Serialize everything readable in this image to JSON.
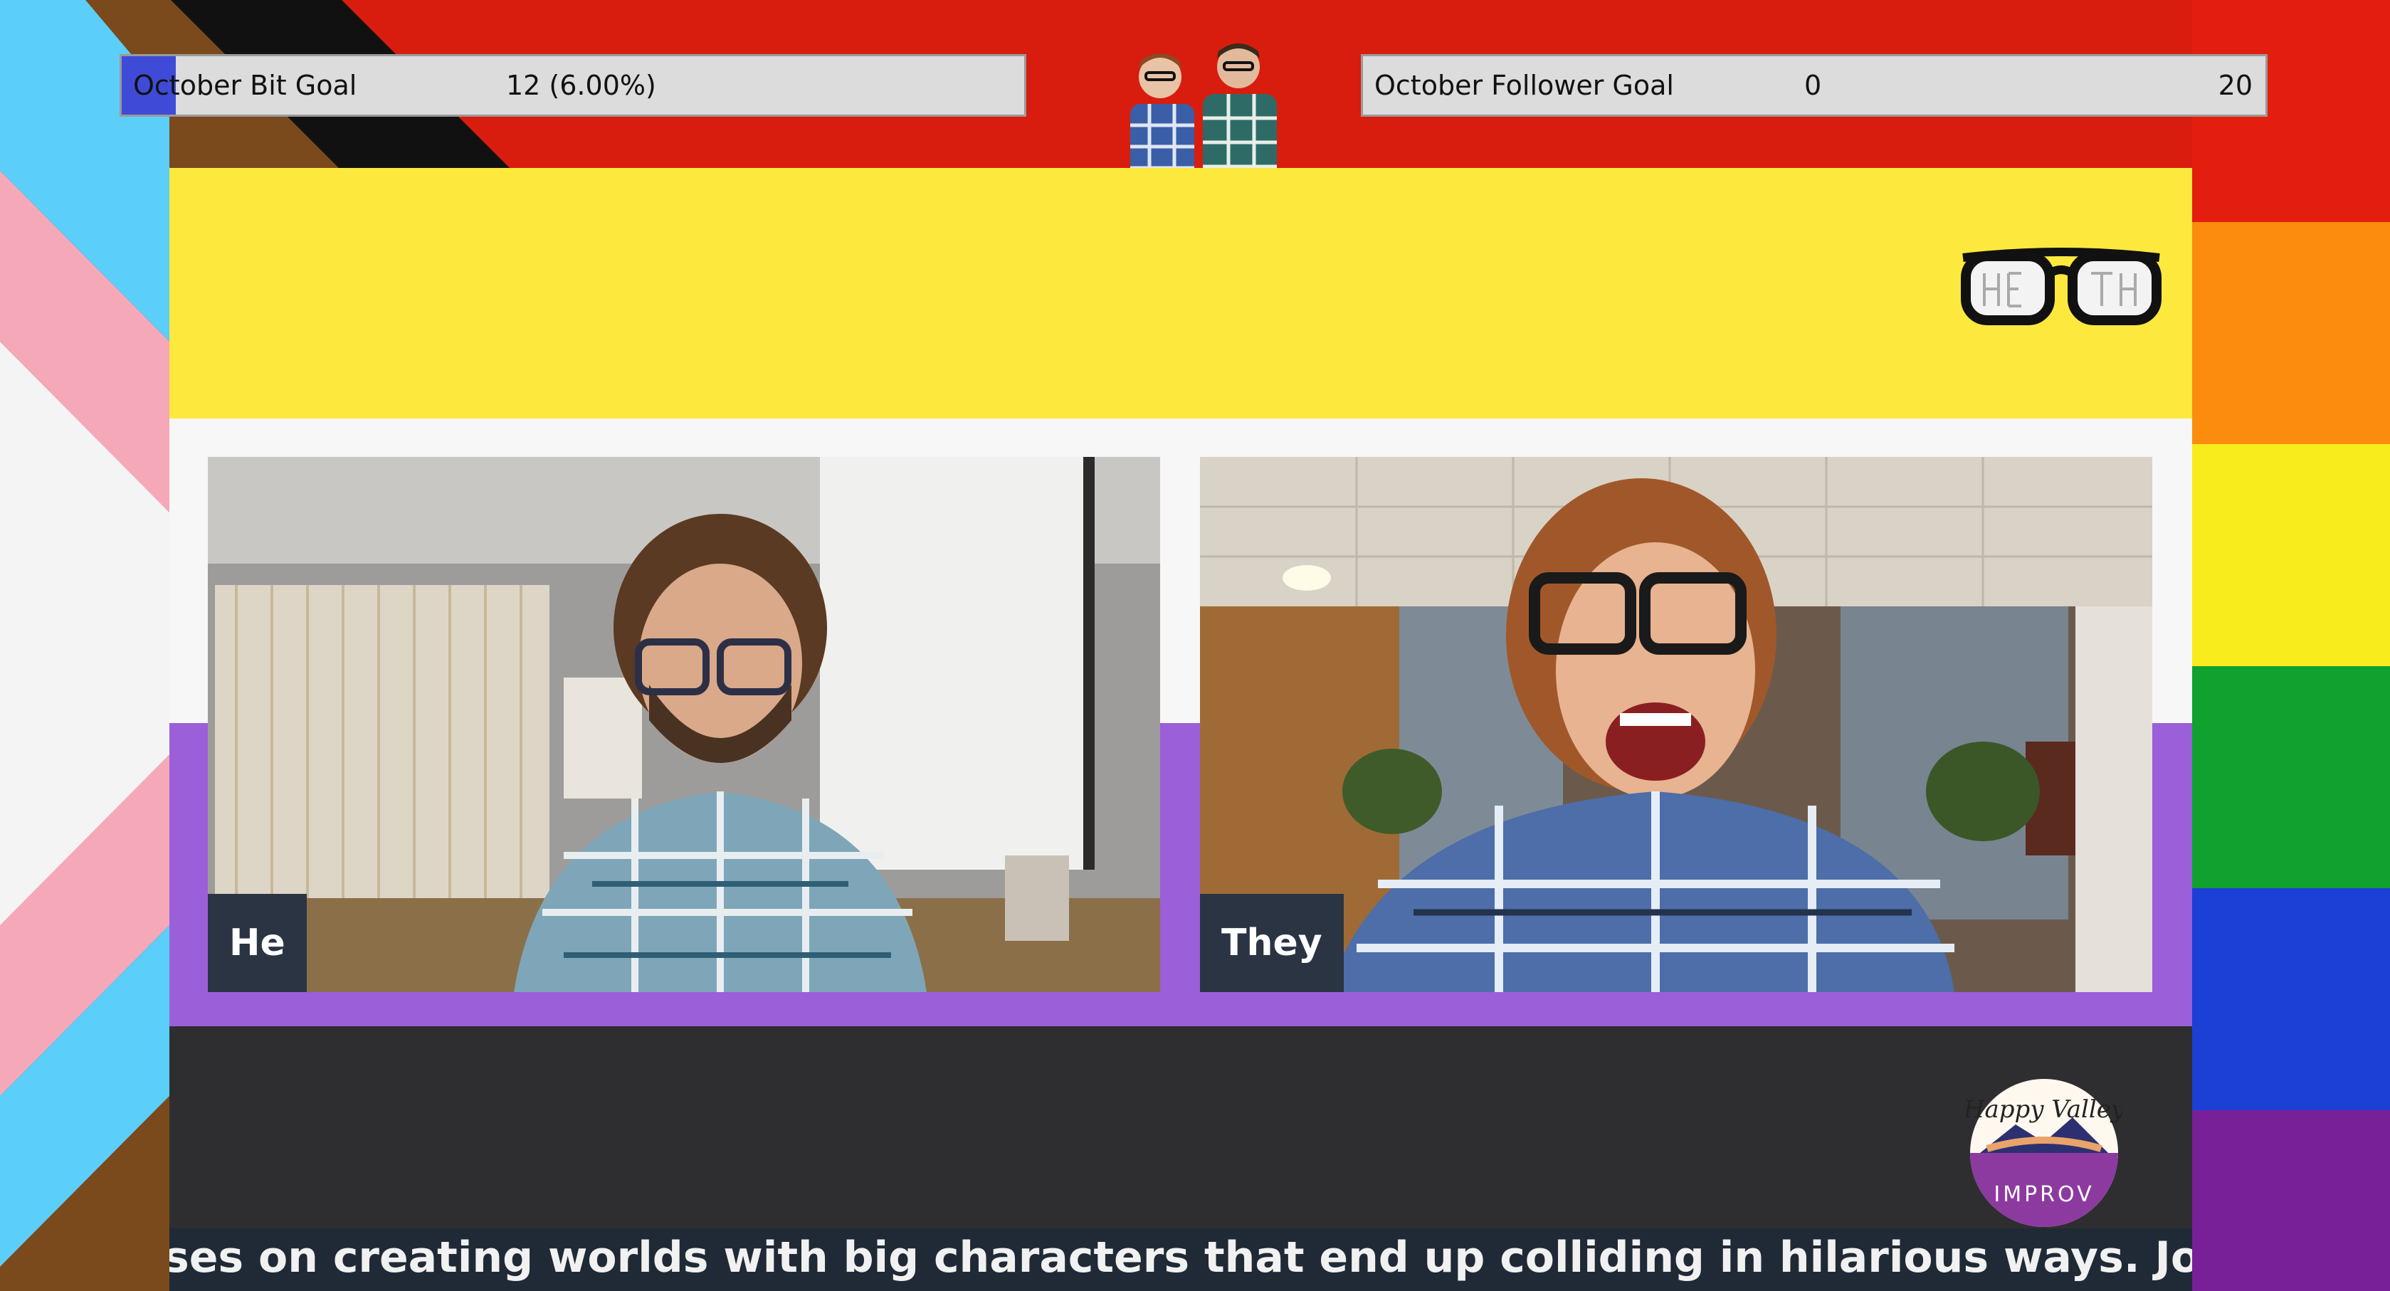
{
  "overlay": {
    "bit_goal": {
      "label": "October Bit Goal",
      "value_text": "12 (6.00%)",
      "progress": 0.06
    },
    "follower_goal": {
      "label": "October Follower Goal",
      "current": "0",
      "target": "20",
      "progress": 0
    }
  },
  "participants": [
    {
      "tag": "He"
    },
    {
      "tag": "They"
    }
  ],
  "ticker": {
    "text": "ses on creating worlds with big characters that end up colliding in hilarious ways. Join us at :"
  },
  "branding": {
    "logo_lettering": "HE SAID THEY SAID",
    "improv_logo_lettering": "Happy Valley IMPROV"
  },
  "colors": {
    "rainbow": [
      "#e41e0f",
      "#fb8c0d",
      "#f9ec1d",
      "#10a12f",
      "#1c3fd6",
      "#772098"
    ],
    "progress_flag": [
      "#5bcefa",
      "#f5a9b8",
      "#ffffff",
      "#7a4a1c",
      "#111111"
    ],
    "yellow": "#fde93e",
    "purple": "#9b5fd9",
    "dark": "#2e2e30",
    "bit_fill": "#3f4bd6"
  }
}
